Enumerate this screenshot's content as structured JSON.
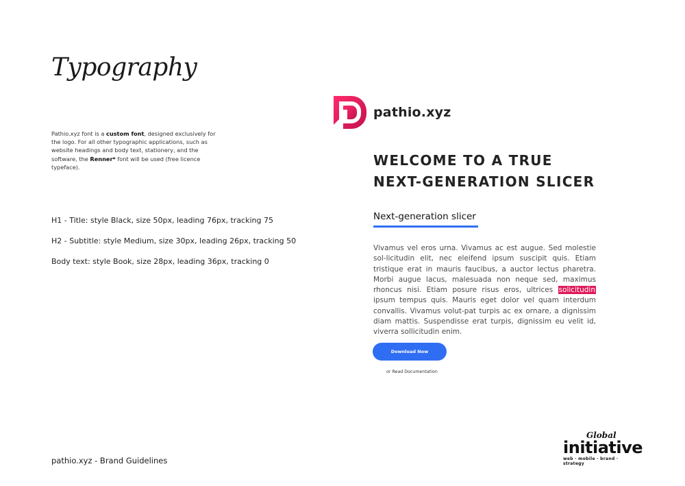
{
  "page": {
    "title": "Typography",
    "footer": "pathio.xyz - Brand Guidelines"
  },
  "intro": {
    "part1": "Pathio.xyz font is a ",
    "bold1": "custom font",
    "part2": ", designed exclusively for the logo. For all other typographic applications, such as website headings and body text, stationery, and the software, the ",
    "bold2": "Renner*",
    "part3": " font will be used (free licence typeface)."
  },
  "specs": [
    "H1 - Title: style Black, size 50px, leading 76px, tracking 75",
    "H2 - Subtitle: style Medium, size 30px, leading 26px, tracking 50",
    "Body text: style Book, size 28px, leading 36px, tracking 0"
  ],
  "sample": {
    "brand_name": "pathio.xyz",
    "headline_line1": "Welcome to a true",
    "headline_line2": "next-generation slicer",
    "subtitle": "Next-generation slicer",
    "body_before": "Vivamus vel eros urna. Vivamus ac est augue. Sed molestie sol-licitudin elit, nec eleifend ipsum suscipit quis. Etiam tristique erat in mauris faucibus, a auctor lectus pharetra. Morbi augue lacus, malesuada non neque sed, maximus rhoncus nisi. Etiam posure risus eros, ultrices ",
    "body_highlight": "solicitudin",
    "body_after": " ipsum tempus quis. Mauris eget dolor vel quam interdum convallis. Vivamus volut-pat turpis ac ex ornare, a dignissim diam mattis. Suspendisse erat turpis, dignissim eu velit id, viverra sollicitudin enim.",
    "button_label": "Download Now",
    "link_label": "or Read Documentation"
  },
  "agency": {
    "script": "Global",
    "name": "initiative",
    "tagline": "web · mobile · brand · strategy"
  },
  "colors": {
    "brand_magenta": "#e0195a",
    "accent_blue": "#2f6ef2"
  }
}
